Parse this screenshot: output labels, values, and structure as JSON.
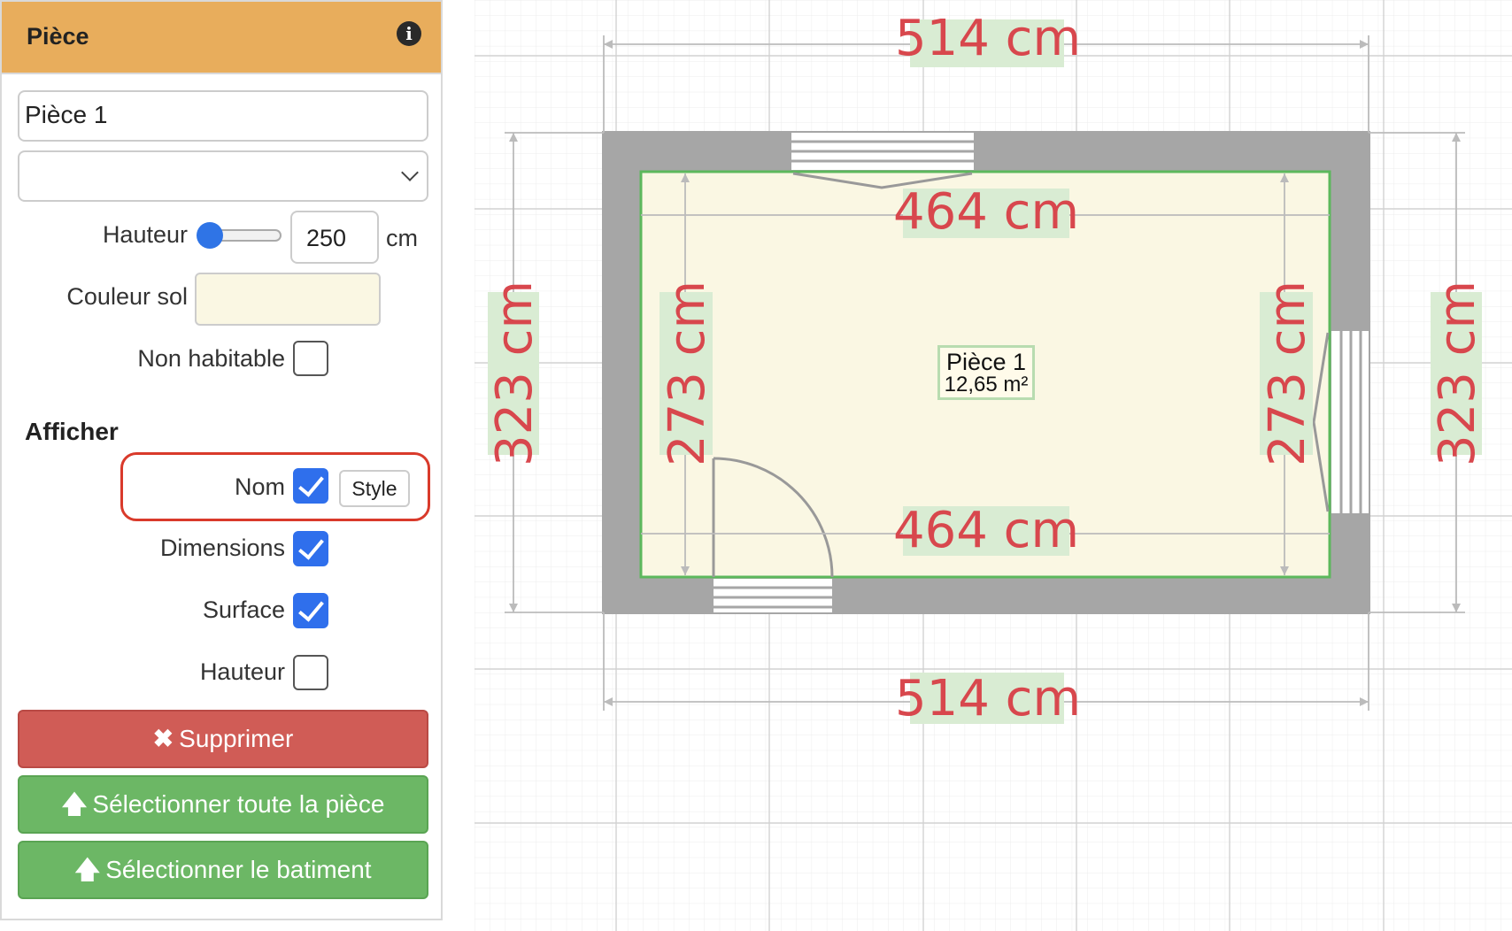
{
  "panel": {
    "title": "Pièce",
    "room_name_value": "Pièce 1",
    "type_select_value": "",
    "height_label": "Hauteur",
    "height_value": "250",
    "height_unit": "cm",
    "floor_color_label": "Couleur sol",
    "floor_color": "#faf7e3",
    "non_habitable_label": "Non habitable",
    "non_habitable_checked": false,
    "show_section_title": "Afficher",
    "show_options": [
      {
        "label": "Nom",
        "checked": true
      },
      {
        "label": "Dimensions",
        "checked": true
      },
      {
        "label": "Surface",
        "checked": true
      },
      {
        "label": "Hauteur",
        "checked": false
      }
    ],
    "style_button_label": "Style",
    "delete_button_label": "Supprimer",
    "select_room_button_label": "Sélectionner toute la pièce",
    "select_building_button_label": "Sélectionner le batiment"
  },
  "plan": {
    "dim_top_outer": "514 cm",
    "dim_top_inner": "464 cm",
    "dim_bottom_inner": "464 cm",
    "dim_bottom_outer": "514 cm",
    "dim_left_outer": "323 cm",
    "dim_left_inner": "273 cm",
    "dim_right_inner": "273 cm",
    "dim_right_outer": "323 cm",
    "room_name": "Pièce 1",
    "room_area": "12,65 m²",
    "colors": {
      "wall": "#a6a6a6",
      "floor": "#faf7e3",
      "floor_border": "#5cb85c",
      "dimension_text": "#d8474d",
      "dimension_bg": "#d9ecd3"
    }
  }
}
